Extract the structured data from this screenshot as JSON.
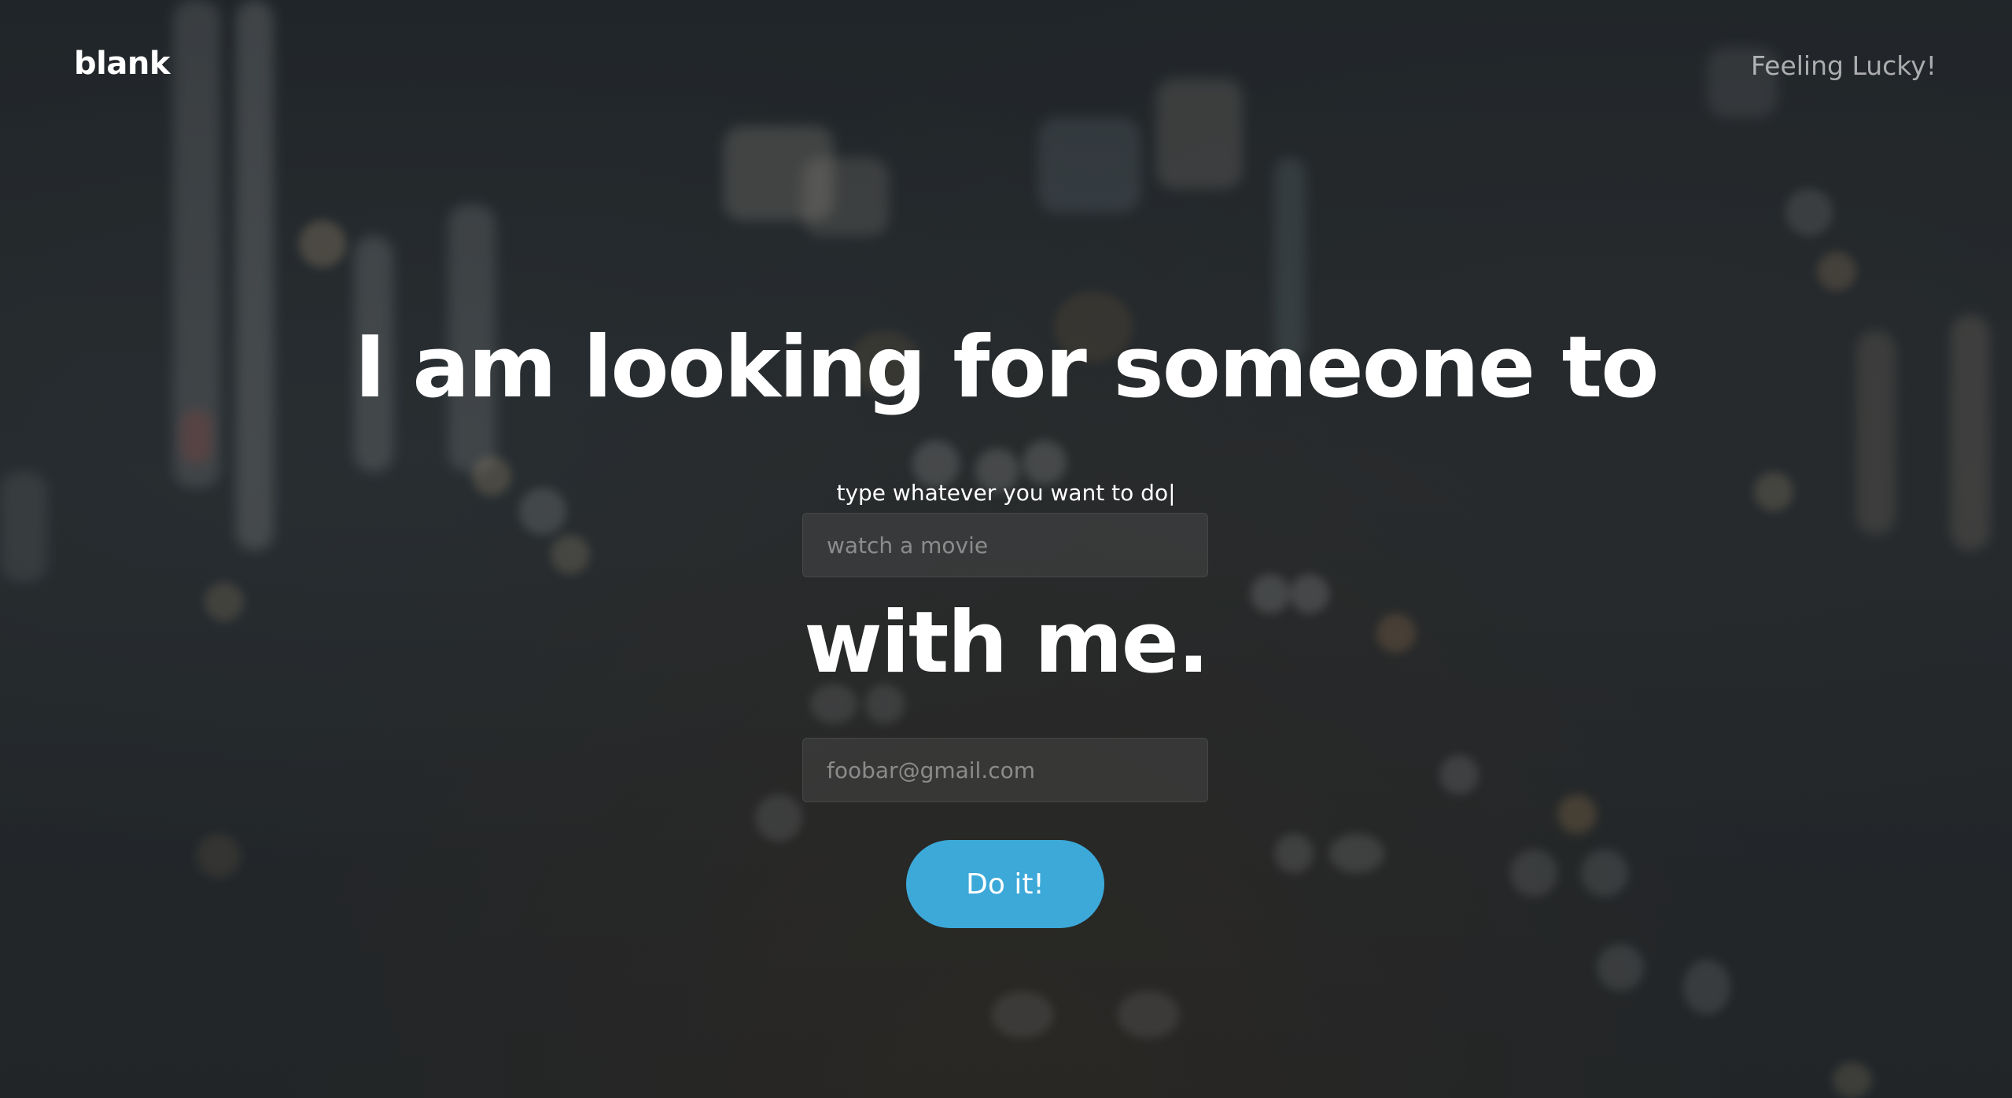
{
  "header": {
    "logo": "blank",
    "lucky_link": "Feeling Lucky!"
  },
  "hero": {
    "headline_top": "I am looking for someone to",
    "hint": "type whatever you want to do|",
    "activity_placeholder": "watch a movie",
    "headline_bottom": "with me.",
    "email_placeholder": "foobar@gmail.com",
    "submit_label": "Do it!"
  },
  "colors": {
    "accent": "#3ca9d9",
    "background": "#262a2e"
  }
}
